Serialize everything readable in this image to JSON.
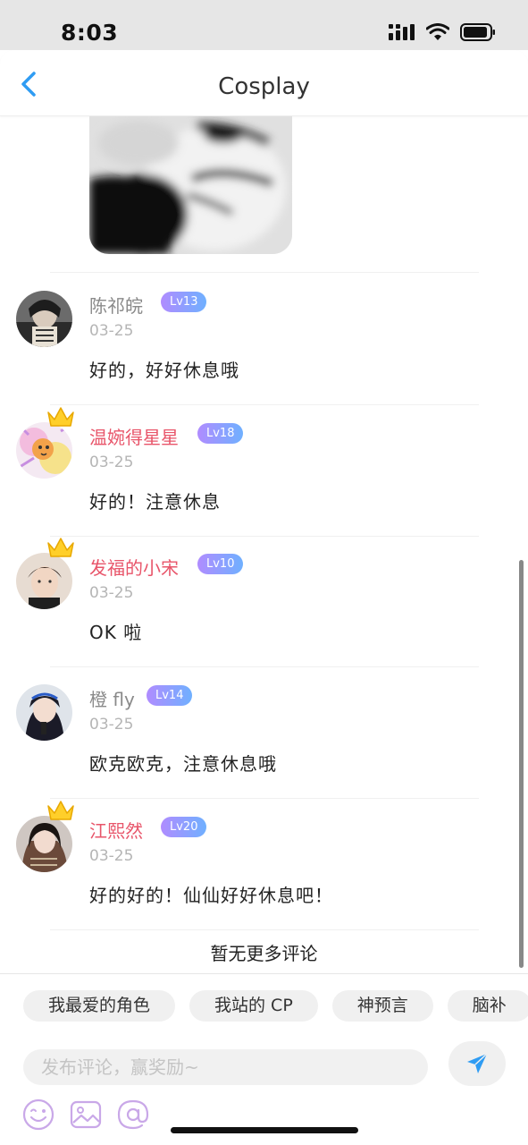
{
  "status": {
    "time": "8:03"
  },
  "nav": {
    "title": "Cosplay"
  },
  "comments": [
    {
      "name": "陈祁皖",
      "level": "Lv13",
      "date": "03-25",
      "text": "好的，好好休息哦"
    },
    {
      "name": "温婉得星星",
      "level": "Lv18",
      "date": "03-25",
      "text": "好的！注意休息"
    },
    {
      "name": "发福的小宋",
      "level": "Lv10",
      "date": "03-25",
      "text": "OK 啦"
    },
    {
      "name": "橙 fly",
      "level": "Lv14",
      "date": "03-25",
      "text": "欧克欧克，注意休息哦"
    },
    {
      "name": "江熙然",
      "level": "Lv20",
      "date": "03-25",
      "text": "好的好的！仙仙好好休息吧！"
    }
  ],
  "footer_note": "暂无更多评论",
  "tags": [
    "我最爱的角色",
    "我站的 CP",
    "神预言",
    "脑补"
  ],
  "input": {
    "placeholder": "发布评论，赢奖励~"
  },
  "icons": [
    "back-chevron-icon",
    "signal-icon",
    "wifi-icon",
    "battery-icon",
    "crown-icon",
    "send-icon",
    "emoji-icon",
    "image-icon",
    "at-icon"
  ],
  "colors": {
    "accent": "#2f9cf3",
    "vip_name": "#e8556a",
    "level_badge_start": "#b08cff",
    "level_badge_end": "#6fb0ff"
  }
}
